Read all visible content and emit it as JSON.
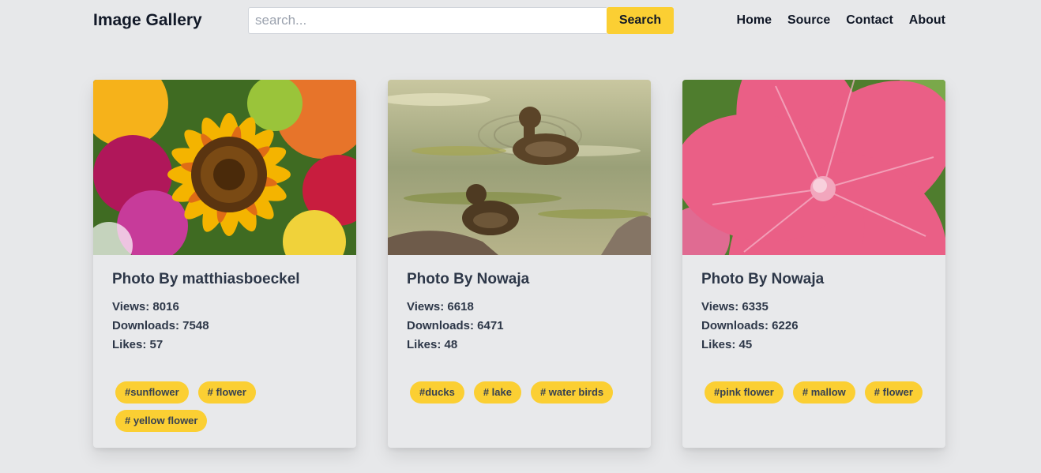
{
  "header": {
    "brand": "Image Gallery",
    "search_placeholder": "search...",
    "search_value": "",
    "search_button": "Search",
    "nav": [
      "Home",
      "Source",
      "Contact",
      "About"
    ]
  },
  "colors": {
    "accent": "#fbcf33",
    "background": "#e7e8ea",
    "text": "#2d3748"
  },
  "cards": [
    {
      "title": "Photo By matthiasboeckel",
      "views": "Views: 8016",
      "downloads": "Downloads: 7548",
      "likes": "Likes: 57",
      "tags": [
        "#sunflower",
        "# flower",
        "# yellow flower"
      ]
    },
    {
      "title": "Photo By Nowaja",
      "views": "Views: 6618",
      "downloads": "Downloads: 6471",
      "likes": "Likes: 48",
      "tags": [
        "#ducks",
        "# lake",
        "# water birds"
      ]
    },
    {
      "title": "Photo By Nowaja",
      "views": "Views: 6335",
      "downloads": "Downloads: 6226",
      "likes": "Likes: 45",
      "tags": [
        "#pink flower",
        "# mallow",
        "# flower"
      ]
    }
  ]
}
